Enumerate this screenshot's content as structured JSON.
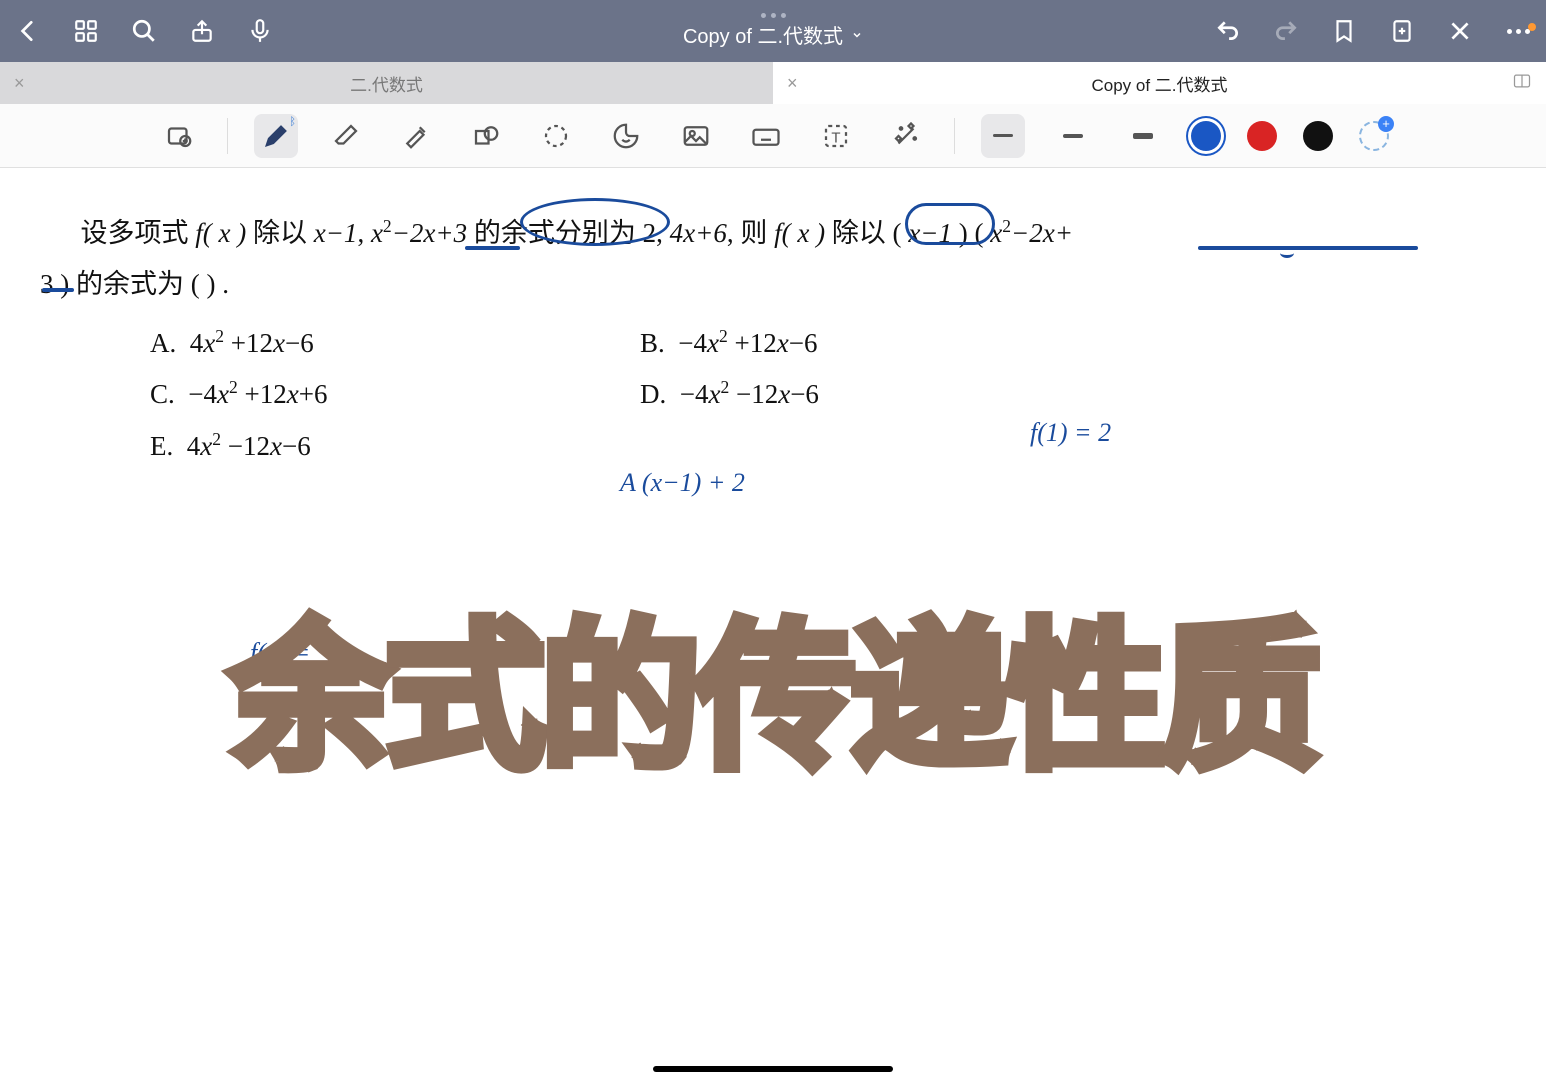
{
  "header": {
    "title": "Copy of 二.代数式"
  },
  "tabs": [
    {
      "label": "二.代数式",
      "active": false
    },
    {
      "label": "Copy of 二.代数式",
      "active": true
    }
  ],
  "colors": {
    "blue": "#1a57c4",
    "red": "#d92424",
    "black": "#111111"
  },
  "problem": {
    "stem_prefix": "设多项式 ",
    "fx": "f( x )",
    "divby": " 除以 ",
    "d1": "x−1",
    "comma1": ", ",
    "d2_a": "x",
    "d2_b": "−2x+3",
    "rem_label": " 的余式分别为 ",
    "r1": "2",
    "comma2": ", ",
    "r2": "4x+6",
    "then": ", 则 ",
    "fx2": "f( x )",
    "divby2": " 除以 ( ",
    "p1": "x−1",
    "paren_mid": " ) ( ",
    "p2_a": "x",
    "p2_b": "−2x+",
    "line2_a": "3",
    "line2_b": " ) 的余式为 (        ) ."
  },
  "options": {
    "A": "A.  4x² +12x−6",
    "B": "B.  −4x² +12x−6",
    "C": "C.  −4x² +12x+6",
    "D": "D.  −4x² −12x−6",
    "E": "E.  4x² −12x−6"
  },
  "handwriting": {
    "note1": "f(1) = 2",
    "note2": "A (x−1) + 2",
    "note3": "f(x) ="
  },
  "overlay_title": "余式的传递性质"
}
